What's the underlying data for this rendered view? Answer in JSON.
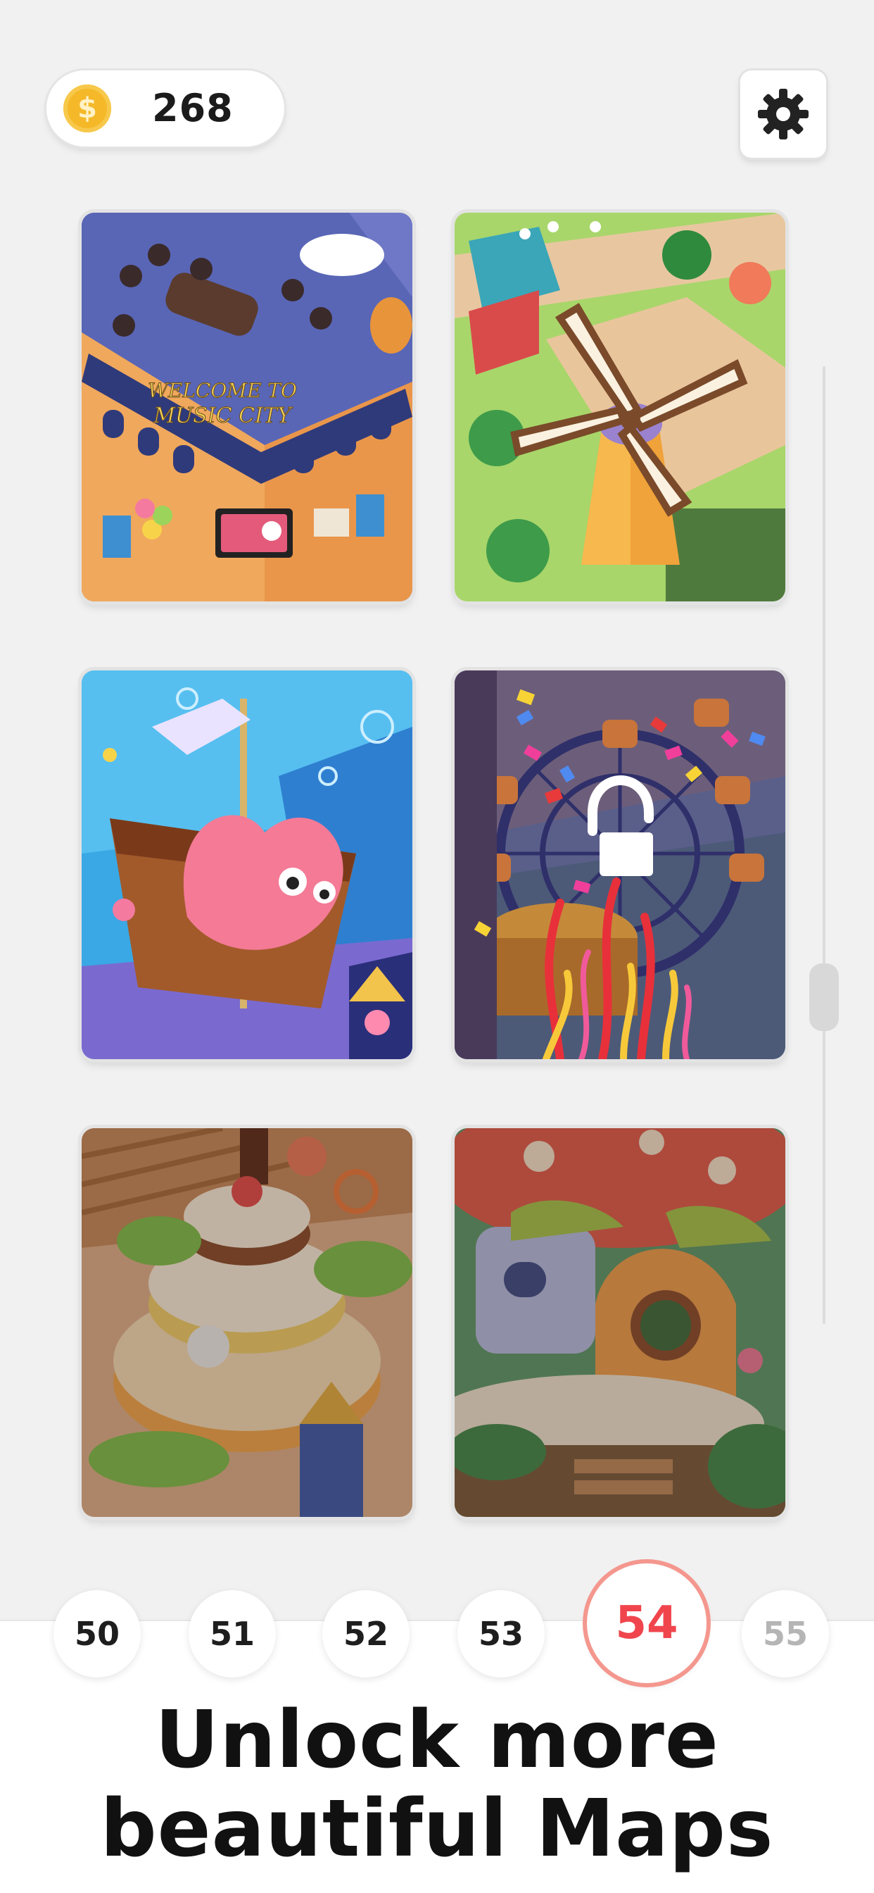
{
  "header": {
    "coin_symbol": "$",
    "coins": "268",
    "settings_icon": "gear-icon"
  },
  "maps": [
    {
      "name": "music-city",
      "sign_line1": "WELCOME TO",
      "sign_line2": "MUSIC CITY",
      "locked": false
    },
    {
      "name": "windmill-farm",
      "locked": false
    },
    {
      "name": "underwater-pirate-ship",
      "locked": false
    },
    {
      "name": "ferris-wheel-park",
      "locked": true,
      "icon": "unlock-icon"
    },
    {
      "name": "candy-cake-land",
      "locked": true
    },
    {
      "name": "mushroom-village",
      "locked": true
    }
  ],
  "levels": [
    {
      "label": "50"
    },
    {
      "label": "51"
    },
    {
      "label": "52"
    },
    {
      "label": "53"
    },
    {
      "label": "54",
      "current": true
    },
    {
      "label": "55"
    }
  ],
  "headline": {
    "line1": "Unlock more",
    "line2": "beautiful Maps"
  },
  "colors": {
    "background": "#f1f1f1",
    "accent": "#f0454d",
    "coin": "#f4b829"
  }
}
